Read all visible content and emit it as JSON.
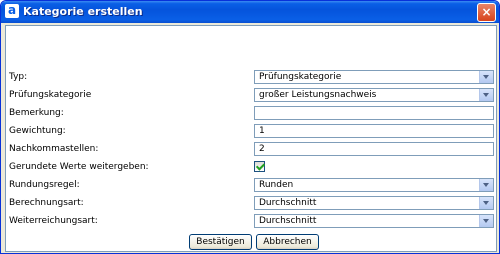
{
  "window": {
    "title": "Kategorie erstellen",
    "icon_letter": "a"
  },
  "form": {
    "typ": {
      "label": "Typ:",
      "value": "Prüfungskategorie"
    },
    "pruefungskategorie": {
      "label": "Prüfungskategorie",
      "value": "großer Leistungsnachweis"
    },
    "bemerkung": {
      "label": "Bemerkung:",
      "value": ""
    },
    "gewichtung": {
      "label": "Gewichtung:",
      "value": "1"
    },
    "nachkommastellen": {
      "label": "Nachkommastellen:",
      "value": "2"
    },
    "gerundete": {
      "label": "Gerundete Werte weitergeben:",
      "checked": true
    },
    "rundungsregel": {
      "label": "Rundungsregel:",
      "value": "Runden"
    },
    "berechnungsart": {
      "label": "Berechnungsart:",
      "value": "Durchschnitt"
    },
    "weiterreichungsart": {
      "label": "Weiterreichungsart:",
      "value": "Durchschnitt"
    }
  },
  "buttons": {
    "confirm": "Bestätigen",
    "cancel": "Abbrechen"
  },
  "colors": {
    "titlebar": "#0554dc",
    "close": "#d8431c",
    "border": "#7f9db9"
  }
}
